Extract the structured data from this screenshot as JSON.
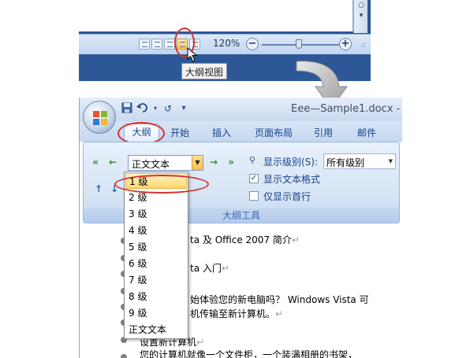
{
  "status_bar": {
    "zoom_label": "120%",
    "zoom_minus": "−",
    "zoom_plus": "+",
    "tooltip": "大纲视图"
  },
  "word": {
    "title": "Eee—Sample1.docx -",
    "quick_access": {
      "redo_glyph": "↺",
      "customize_glyph": "▾"
    },
    "tabs": [
      "大纲",
      "开始",
      "插入",
      "页面布局",
      "引用",
      "邮件"
    ],
    "ribbon": {
      "group_label": "大纲工具",
      "level_combo_value": "正文文本",
      "show_level_label": "显示级别(S):",
      "show_level_value": "所有级别",
      "show_text_format": "显示文本格式",
      "show_first_line": "仅显示首行",
      "show_text_format_checked": true,
      "show_first_line_checked": false
    },
    "dropdown_items": [
      "1 级",
      "2 级",
      "3 级",
      "4 级",
      "5 级",
      "6 级",
      "7 级",
      "8 级",
      "9 级",
      "正文文本"
    ],
    "doc_lines": [
      "ta 及 Office 2007 简介",
      "ta 入门",
      "始体验您的新电脑吗？ Windows Vista 可",
      "机传输至新计算机。",
      "设置新计算机",
      "您的计算机就像一个文件柜，一个装满相册的书架，"
    ]
  }
}
